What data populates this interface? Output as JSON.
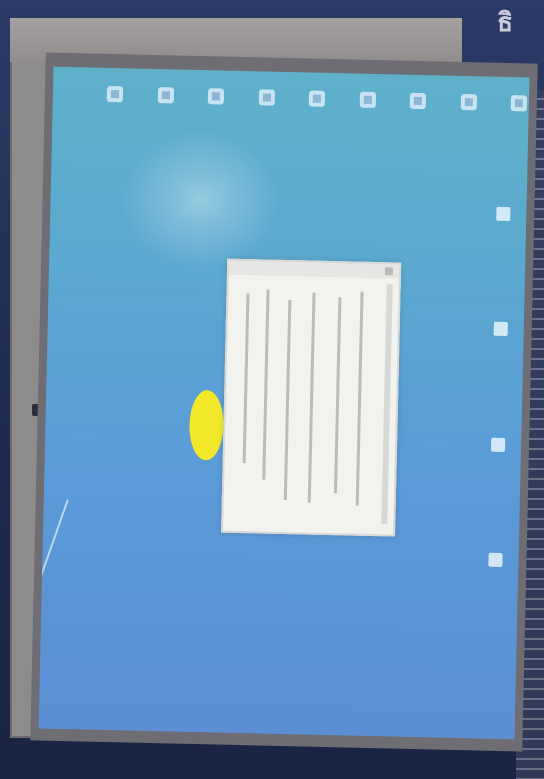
{
  "photo": {
    "corner_label": "ธิ",
    "screen": {
      "top_icons": [
        "icon",
        "icon",
        "icon",
        "icon",
        "icon",
        "icon",
        "icon",
        "icon",
        "icon"
      ],
      "right_icons": [
        "icon",
        "icon",
        "icon",
        "icon"
      ],
      "window": {
        "title": "",
        "text_lines": [
          "",
          "",
          "",
          "",
          "",
          ""
        ]
      }
    }
  }
}
